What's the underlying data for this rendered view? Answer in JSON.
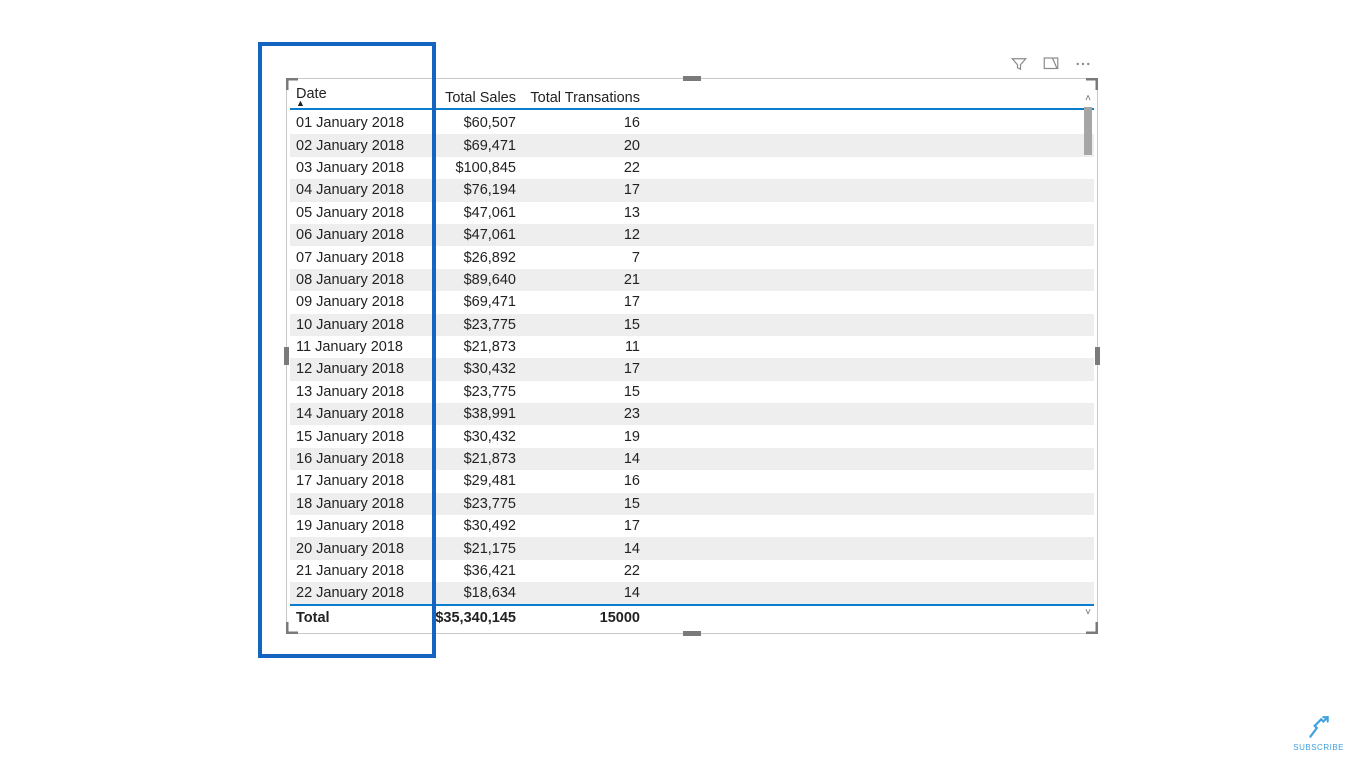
{
  "toolbar": {
    "filter_icon": "filter-icon",
    "focus_icon": "focus-mode-icon",
    "more_icon": "more-options-icon"
  },
  "table": {
    "columns": {
      "date": "Date",
      "sales": "Total Sales",
      "trans": "Total Transations"
    },
    "sort_column": "date",
    "sort_direction": "asc",
    "rows": [
      {
        "date": "01 January 2018",
        "sales": "$60,507",
        "trans": "16"
      },
      {
        "date": "02 January 2018",
        "sales": "$69,471",
        "trans": "20"
      },
      {
        "date": "03 January 2018",
        "sales": "$100,845",
        "trans": "22"
      },
      {
        "date": "04 January 2018",
        "sales": "$76,194",
        "trans": "17"
      },
      {
        "date": "05 January 2018",
        "sales": "$47,061",
        "trans": "13"
      },
      {
        "date": "06 January 2018",
        "sales": "$47,061",
        "trans": "12"
      },
      {
        "date": "07 January 2018",
        "sales": "$26,892",
        "trans": "7"
      },
      {
        "date": "08 January 2018",
        "sales": "$89,640",
        "trans": "21"
      },
      {
        "date": "09 January 2018",
        "sales": "$69,471",
        "trans": "17"
      },
      {
        "date": "10 January 2018",
        "sales": "$23,775",
        "trans": "15"
      },
      {
        "date": "11 January 2018",
        "sales": "$21,873",
        "trans": "11"
      },
      {
        "date": "12 January 2018",
        "sales": "$30,432",
        "trans": "17"
      },
      {
        "date": "13 January 2018",
        "sales": "$23,775",
        "trans": "15"
      },
      {
        "date": "14 January 2018",
        "sales": "$38,991",
        "trans": "23"
      },
      {
        "date": "15 January 2018",
        "sales": "$30,432",
        "trans": "19"
      },
      {
        "date": "16 January 2018",
        "sales": "$21,873",
        "trans": "14"
      },
      {
        "date": "17 January 2018",
        "sales": "$29,481",
        "trans": "16"
      },
      {
        "date": "18 January 2018",
        "sales": "$23,775",
        "trans": "15"
      },
      {
        "date": "19 January 2018",
        "sales": "$30,492",
        "trans": "17"
      },
      {
        "date": "20 January 2018",
        "sales": "$21,175",
        "trans": "14"
      },
      {
        "date": "21 January 2018",
        "sales": "$36,421",
        "trans": "22"
      },
      {
        "date": "22 January 2018",
        "sales": "$18,634",
        "trans": "14"
      }
    ],
    "total": {
      "label": "Total",
      "sales": "$35,340,145",
      "trans": "15000"
    }
  },
  "watermark": {
    "label": "SUBSCRIBE"
  }
}
